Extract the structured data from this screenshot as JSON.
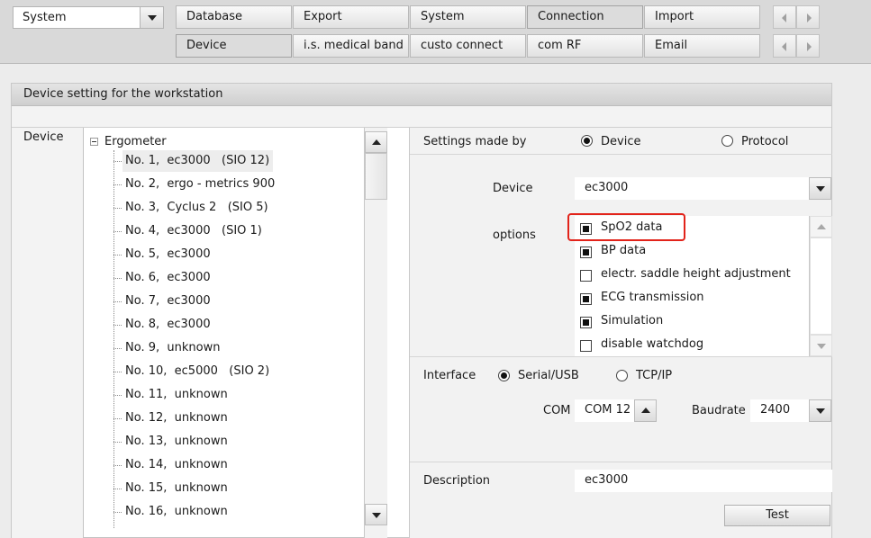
{
  "topbar": {
    "module_select": "System",
    "tabs_row1": [
      "Database",
      "Export",
      "System",
      "Connection",
      "Import"
    ],
    "tabs_row2": [
      "Device",
      "i.s. medical band",
      "custo connect",
      "com RF",
      "Email"
    ],
    "active_row1": "Connection",
    "active_row2": "Device"
  },
  "panel": {
    "title": "Device setting for the workstation",
    "device_label": "Device"
  },
  "tree": {
    "root": "Ergometer",
    "items": [
      "No. 1,  ec3000   (SIO 12)",
      "No. 2,  ergo - metrics 900",
      "No. 3,  Cyclus 2   (SIO 5)",
      "No. 4,  ec3000   (SIO 1)",
      "No. 5,  ec3000",
      "No. 6,  ec3000",
      "No. 7,  ec3000",
      "No. 8,  ec3000",
      "No. 9,  unknown",
      "No. 10,  ec5000   (SIO 2)",
      "No. 11,  unknown",
      "No. 12,  unknown",
      "No. 13,  unknown",
      "No. 14,  unknown",
      "No. 15,  unknown",
      "No. 16,  unknown"
    ],
    "selected_index": 0
  },
  "settings": {
    "made_by_label": "Settings made by",
    "radio_device": "Device",
    "radio_protocol": "Protocol",
    "device_label": "Device",
    "device_value": "ec3000",
    "options_label": "options",
    "options": [
      {
        "label": "SpO2 data",
        "checked": true,
        "highlighted": true
      },
      {
        "label": "BP data",
        "checked": true
      },
      {
        "label": "electr. saddle height adjustment",
        "checked": false
      },
      {
        "label": "ECG transmission",
        "checked": true
      },
      {
        "label": "Simulation",
        "checked": true
      },
      {
        "label": "disable watchdog",
        "checked": false
      }
    ],
    "interface_label": "Interface",
    "radio_serial": "Serial/USB",
    "radio_tcp": "TCP/IP",
    "com_label": "COM",
    "com_value": "COM 12",
    "baud_label": "Baudrate",
    "baud_value": "2400",
    "description_label": "Description",
    "description_value": "ec3000",
    "test_button": "Test"
  },
  "colors": {
    "highlight": "#e2231a",
    "toolbar_bg": "#d9d9d9"
  }
}
